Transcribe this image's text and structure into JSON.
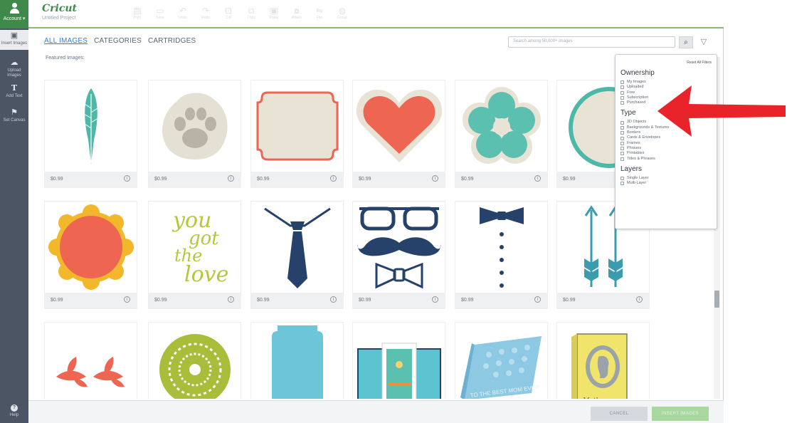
{
  "rail": {
    "account_label": "Account ▾",
    "items": [
      {
        "label": "Insert Images",
        "icon": "image-icon",
        "glyph": "▣"
      },
      {
        "label": "Upload Images",
        "icon": "cloud-upload-icon",
        "glyph": "☁"
      },
      {
        "label": "Add Text",
        "icon": "text-icon",
        "glyph": "T"
      },
      {
        "label": "Set Canvas",
        "icon": "shirt-icon",
        "glyph": "⚑"
      }
    ],
    "help_label": "Help"
  },
  "header": {
    "logo": "Cricut",
    "project_name": "Untitled Project",
    "tools": [
      "Print",
      "Save",
      "Undo",
      "Redo",
      "Cut",
      "Copy",
      "Paste",
      "Attach",
      "Flip",
      "Group"
    ]
  },
  "nav": {
    "tabs": [
      "ALL IMAGES",
      "CATEGORIES",
      "CARTRIDGES"
    ],
    "active": "ALL IMAGES"
  },
  "search": {
    "placeholder": "Search among 50,000+ images"
  },
  "content": {
    "featured_label": "Featured Images:"
  },
  "images": [
    {
      "name": "feather",
      "price": "$0.99"
    },
    {
      "name": "paw-print",
      "price": "$0.99"
    },
    {
      "name": "label-frame",
      "price": "$0.99"
    },
    {
      "name": "heart",
      "price": "$0.99"
    },
    {
      "name": "flower",
      "price": "$0.99"
    },
    {
      "name": "circle-frame",
      "price": "$0.99"
    },
    {
      "name": "scalloped-circle",
      "price": "$0.99"
    },
    {
      "name": "you-got-the-love",
      "price": "$0.99"
    },
    {
      "name": "necktie",
      "price": "$0.99"
    },
    {
      "name": "glasses-mustache-bowtie",
      "price": "$0.99"
    },
    {
      "name": "bowtie-buttons",
      "price": "$0.99"
    },
    {
      "name": "arrows",
      "price": "$0.99"
    },
    {
      "name": "leaves",
      "price": ""
    },
    {
      "name": "doily",
      "price": ""
    },
    {
      "name": "tag",
      "price": ""
    },
    {
      "name": "card",
      "price": ""
    },
    {
      "name": "best-mom-card",
      "price": ""
    },
    {
      "name": "silhouette-card",
      "price": ""
    }
  ],
  "filters": {
    "reset_label": "Reset All Filters",
    "ownership_title": "Ownership",
    "ownership": [
      "My Images",
      "Uploaded",
      "Free",
      "Subscription",
      "Purchased"
    ],
    "type_title": "Type",
    "type": [
      "3D Objects",
      "Backgrounds & Textures",
      "Borders",
      "Cards & Envelopes",
      "Frames",
      "Phrases",
      "Printables",
      "Titles & Phrases"
    ],
    "layers_title": "Layers",
    "layers": [
      "Single Layer",
      "Multi-Layer"
    ]
  },
  "footer": {
    "cancel_label": "CANCEL",
    "insert_label": "INSERT IMAGES"
  },
  "colors": {
    "brand_green": "#3f8a4a",
    "annotation_red": "#e8232a",
    "teal": "#4db8a8",
    "coral": "#ee6552"
  }
}
